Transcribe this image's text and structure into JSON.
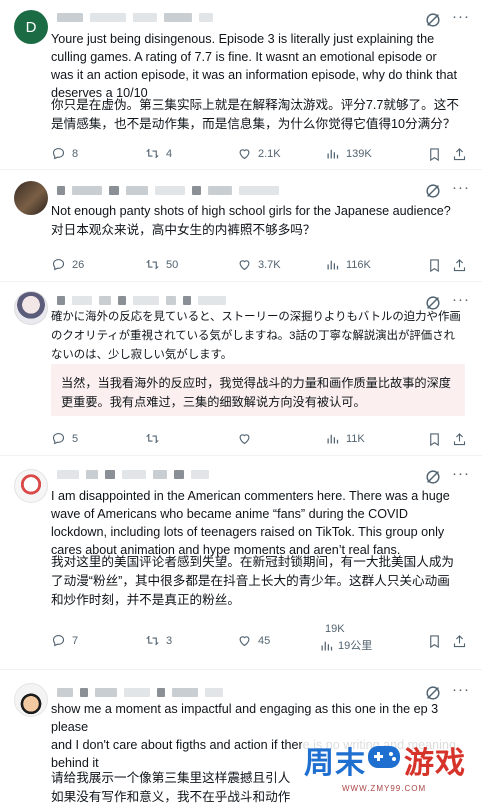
{
  "posts": [
    {
      "avatar_letter": "D",
      "lang": "en",
      "text": "Youre just being disingenous. Episode 3 is literally just explaining the culling games. A rating of 7.7 is fine. It wasnt an emotional episode or was it an action episode, it was an information episode, why do think that deserves a 10/10",
      "translation": "你只是在虚伪。第三集实际上就是在解释淘汰游戏。评分7.7就够了。这不是情感集，也不是动作集，而是信息集，为什么你觉得它值得10分满分？",
      "replies": "8",
      "reposts": "4",
      "likes": "2.1K",
      "views": "139K"
    },
    {
      "lang": "en",
      "text": "Not enough panty shots of high school girls for the Japanese audience?",
      "translation": "对日本观众来说，高中女生的内裤照不够多吗？",
      "replies": "26",
      "reposts": "50",
      "likes": "3.7K",
      "views": "116K"
    },
    {
      "lang": "ja",
      "text": "確かに海外の反応を見ていると、ストーリーの深掘りよりもバトルの迫力や作画のクオリティが重視されている気がしますね。3話の丁寧な解説演出が評価されないのは、少し寂しい気がします。",
      "translation": "当然，当我看海外的反应时，我觉得战斗的力量和画作质量比故事的深度更重要。我有点难过，三集的细致解说方向没有被认可。",
      "replies": "5",
      "reposts": "",
      "likes": "",
      "views": "11K"
    },
    {
      "lang": "en",
      "text": "I am disappointed in the American commenters here. There was a huge wave of Americans who became anime “fans” during the COVID lockdown, including lots of teenagers raised on TikTok. This group only cares about animation and hype moments and aren’t real fans.",
      "translation": "我对这里的美国评论者感到失望。在新冠封锁期间，有一大批美国人成为了动漫“粉丝”，其中很多都是在抖音上长大的青少年。这群人只关心动画和炒作时刻，并不是真正的粉丝。",
      "replies": "7",
      "reposts": "3",
      "likes": "45",
      "views": "19K",
      "views_zh": "19公里"
    },
    {
      "lang": "en",
      "text": "show me a moment as impactful and engaging as this one in the ep 3 please\nand I don't care about figths and action if there is no writing and meaning behind it",
      "translation": "请给我展示一个像第三集里这样震撼且引人\n如果没有写作和意义，我不在乎战斗和动作"
    }
  ],
  "watermark": {
    "part1": "周末",
    "part2": "游戏",
    "url": "WWW.ZMY99.COM"
  },
  "colors": {
    "text": "#0f1419",
    "muted": "#536471",
    "border": "#eff3f4",
    "translation_bg": "#fbf0ef",
    "wm_blue": "#1f6fd1",
    "wm_red": "#d6332a"
  }
}
